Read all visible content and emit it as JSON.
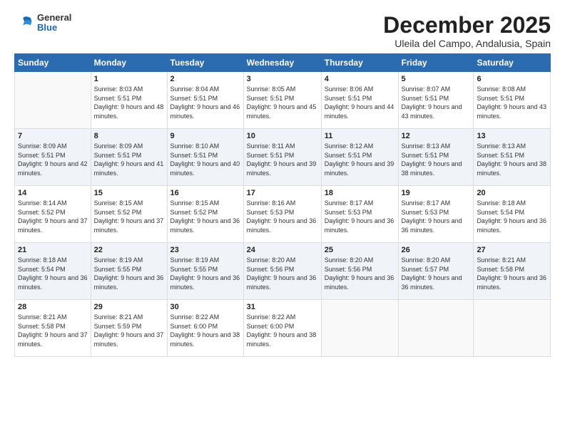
{
  "header": {
    "logo_general": "General",
    "logo_blue": "Blue",
    "main_title": "December 2025",
    "subtitle": "Uleila del Campo, Andalusia, Spain"
  },
  "calendar": {
    "days_of_week": [
      "Sunday",
      "Monday",
      "Tuesday",
      "Wednesday",
      "Thursday",
      "Friday",
      "Saturday"
    ],
    "weeks": [
      [
        {
          "day": "",
          "empty": true
        },
        {
          "day": "1",
          "sunrise": "8:03 AM",
          "sunset": "5:51 PM",
          "daylight": "9 hours and 48 minutes."
        },
        {
          "day": "2",
          "sunrise": "8:04 AM",
          "sunset": "5:51 PM",
          "daylight": "9 hours and 46 minutes."
        },
        {
          "day": "3",
          "sunrise": "8:05 AM",
          "sunset": "5:51 PM",
          "daylight": "9 hours and 45 minutes."
        },
        {
          "day": "4",
          "sunrise": "8:06 AM",
          "sunset": "5:51 PM",
          "daylight": "9 hours and 44 minutes."
        },
        {
          "day": "5",
          "sunrise": "8:07 AM",
          "sunset": "5:51 PM",
          "daylight": "9 hours and 43 minutes."
        },
        {
          "day": "6",
          "sunrise": "8:08 AM",
          "sunset": "5:51 PM",
          "daylight": "9 hours and 43 minutes."
        }
      ],
      [
        {
          "day": "7",
          "sunrise": "8:09 AM",
          "sunset": "5:51 PM",
          "daylight": "9 hours and 42 minutes."
        },
        {
          "day": "8",
          "sunrise": "8:09 AM",
          "sunset": "5:51 PM",
          "daylight": "9 hours and 41 minutes."
        },
        {
          "day": "9",
          "sunrise": "8:10 AM",
          "sunset": "5:51 PM",
          "daylight": "9 hours and 40 minutes."
        },
        {
          "day": "10",
          "sunrise": "8:11 AM",
          "sunset": "5:51 PM",
          "daylight": "9 hours and 39 minutes."
        },
        {
          "day": "11",
          "sunrise": "8:12 AM",
          "sunset": "5:51 PM",
          "daylight": "9 hours and 39 minutes."
        },
        {
          "day": "12",
          "sunrise": "8:13 AM",
          "sunset": "5:51 PM",
          "daylight": "9 hours and 38 minutes."
        },
        {
          "day": "13",
          "sunrise": "8:13 AM",
          "sunset": "5:51 PM",
          "daylight": "9 hours and 38 minutes."
        }
      ],
      [
        {
          "day": "14",
          "sunrise": "8:14 AM",
          "sunset": "5:52 PM",
          "daylight": "9 hours and 37 minutes."
        },
        {
          "day": "15",
          "sunrise": "8:15 AM",
          "sunset": "5:52 PM",
          "daylight": "9 hours and 37 minutes."
        },
        {
          "day": "16",
          "sunrise": "8:15 AM",
          "sunset": "5:52 PM",
          "daylight": "9 hours and 36 minutes."
        },
        {
          "day": "17",
          "sunrise": "8:16 AM",
          "sunset": "5:53 PM",
          "daylight": "9 hours and 36 minutes."
        },
        {
          "day": "18",
          "sunrise": "8:17 AM",
          "sunset": "5:53 PM",
          "daylight": "9 hours and 36 minutes."
        },
        {
          "day": "19",
          "sunrise": "8:17 AM",
          "sunset": "5:53 PM",
          "daylight": "9 hours and 36 minutes."
        },
        {
          "day": "20",
          "sunrise": "8:18 AM",
          "sunset": "5:54 PM",
          "daylight": "9 hours and 36 minutes."
        }
      ],
      [
        {
          "day": "21",
          "sunrise": "8:18 AM",
          "sunset": "5:54 PM",
          "daylight": "9 hours and 36 minutes."
        },
        {
          "day": "22",
          "sunrise": "8:19 AM",
          "sunset": "5:55 PM",
          "daylight": "9 hours and 36 minutes."
        },
        {
          "day": "23",
          "sunrise": "8:19 AM",
          "sunset": "5:55 PM",
          "daylight": "9 hours and 36 minutes."
        },
        {
          "day": "24",
          "sunrise": "8:20 AM",
          "sunset": "5:56 PM",
          "daylight": "9 hours and 36 minutes."
        },
        {
          "day": "25",
          "sunrise": "8:20 AM",
          "sunset": "5:56 PM",
          "daylight": "9 hours and 36 minutes."
        },
        {
          "day": "26",
          "sunrise": "8:20 AM",
          "sunset": "5:57 PM",
          "daylight": "9 hours and 36 minutes."
        },
        {
          "day": "27",
          "sunrise": "8:21 AM",
          "sunset": "5:58 PM",
          "daylight": "9 hours and 36 minutes."
        }
      ],
      [
        {
          "day": "28",
          "sunrise": "8:21 AM",
          "sunset": "5:58 PM",
          "daylight": "9 hours and 37 minutes."
        },
        {
          "day": "29",
          "sunrise": "8:21 AM",
          "sunset": "5:59 PM",
          "daylight": "9 hours and 37 minutes."
        },
        {
          "day": "30",
          "sunrise": "8:22 AM",
          "sunset": "6:00 PM",
          "daylight": "9 hours and 38 minutes."
        },
        {
          "day": "31",
          "sunrise": "8:22 AM",
          "sunset": "6:00 PM",
          "daylight": "9 hours and 38 minutes."
        },
        {
          "day": "",
          "empty": true
        },
        {
          "day": "",
          "empty": true
        },
        {
          "day": "",
          "empty": true
        }
      ]
    ]
  }
}
